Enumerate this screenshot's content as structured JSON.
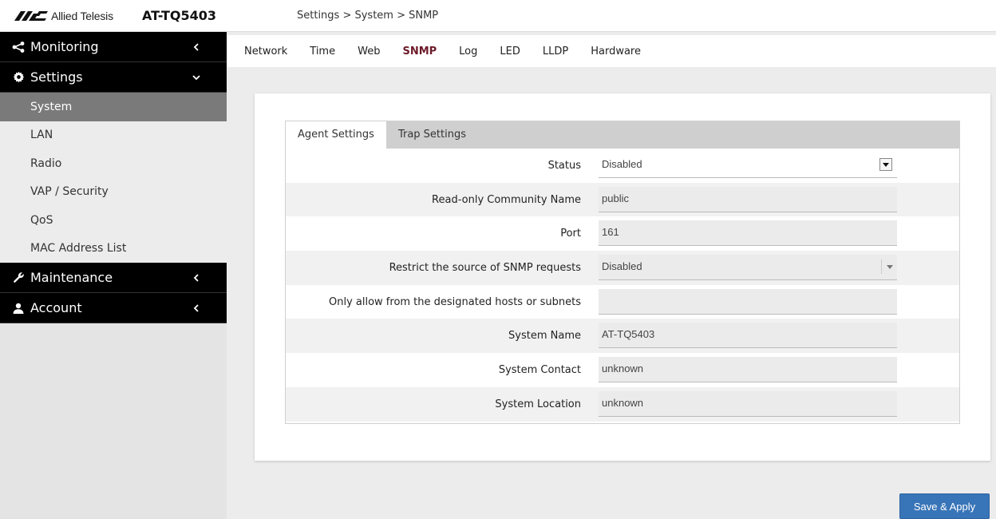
{
  "header": {
    "brand": "Allied Telesis",
    "model": "AT-TQ5403",
    "breadcrumb": "Settings > System > SNMP"
  },
  "sidebar": {
    "sections": [
      {
        "label": "Monitoring",
        "icon": "share-icon",
        "chevron": "chevron-left-icon"
      },
      {
        "label": "Settings",
        "icon": "gear-icon",
        "chevron": "chevron-down-icon"
      },
      {
        "label": "Maintenance",
        "icon": "wrench-icon",
        "chevron": "chevron-left-icon"
      },
      {
        "label": "Account",
        "icon": "user-icon",
        "chevron": "chevron-left-icon"
      }
    ],
    "settings_items": [
      {
        "label": "System",
        "active": true
      },
      {
        "label": "LAN"
      },
      {
        "label": "Radio"
      },
      {
        "label": "VAP / Security"
      },
      {
        "label": "QoS"
      },
      {
        "label": "MAC Address List"
      }
    ]
  },
  "tabs": [
    {
      "label": "Network"
    },
    {
      "label": "Time"
    },
    {
      "label": "Web"
    },
    {
      "label": "SNMP",
      "active": true
    },
    {
      "label": "Log"
    },
    {
      "label": "LED"
    },
    {
      "label": "LLDP"
    },
    {
      "label": "Hardware"
    }
  ],
  "subtabs": [
    {
      "label": "Agent Settings",
      "active": true
    },
    {
      "label": "Trap Settings"
    }
  ],
  "form": [
    {
      "label": "Status",
      "value": "Disabled",
      "type": "select"
    },
    {
      "label": "Read-only Community Name",
      "value": "public",
      "type": "text"
    },
    {
      "label": "Port",
      "value": "161",
      "type": "text"
    },
    {
      "label": "Restrict the source of SNMP requests",
      "value": "Disabled",
      "type": "select-disabled"
    },
    {
      "label": "Only allow from the designated hosts or subnets",
      "value": "",
      "type": "text"
    },
    {
      "label": "System Name",
      "value": "AT-TQ5403",
      "type": "text"
    },
    {
      "label": "System Contact",
      "value": "unknown",
      "type": "text"
    },
    {
      "label": "System Location",
      "value": "unknown",
      "type": "text"
    }
  ],
  "actions": {
    "save_apply": "Save & Apply"
  },
  "colors": {
    "accent_tab": "#6d1a2a",
    "button": "#3874b8",
    "sidebar_head": "#000000",
    "sidebar_active": "#7a7a7a"
  }
}
